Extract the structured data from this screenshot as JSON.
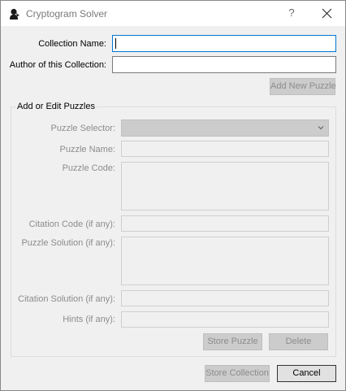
{
  "window": {
    "title": "Cryptogram Solver",
    "help_label": "?",
    "icons": {
      "app": "silhouette-icon",
      "close": "close-icon"
    }
  },
  "form": {
    "collection_name_label": "Collection Name:",
    "collection_name_value": "",
    "author_label": "Author of this Collection:",
    "author_value": "",
    "add_new_puzzle_label": "Add New Puzzle"
  },
  "group": {
    "title": "Add or Edit Puzzles",
    "puzzle_selector_label": "Puzzle Selector:",
    "puzzle_selector_value": "",
    "puzzle_name_label": "Puzzle Name:",
    "puzzle_code_label": "Puzzle Code:",
    "citation_code_label": "Citation Code (if any):",
    "puzzle_solution_label": "Puzzle Solution (if any):",
    "citation_solution_label": "Citation Solution (if any):",
    "hints_label": "Hints (if any):",
    "store_puzzle_label": "Store Puzzle",
    "delete_label": "Delete"
  },
  "footer": {
    "store_collection_label": "Store Collection",
    "cancel_label": "Cancel"
  },
  "colors": {
    "focus_border": "#0078d7",
    "disabled_text": "#8c8c8c",
    "window_bg": "#f0f0f0"
  }
}
